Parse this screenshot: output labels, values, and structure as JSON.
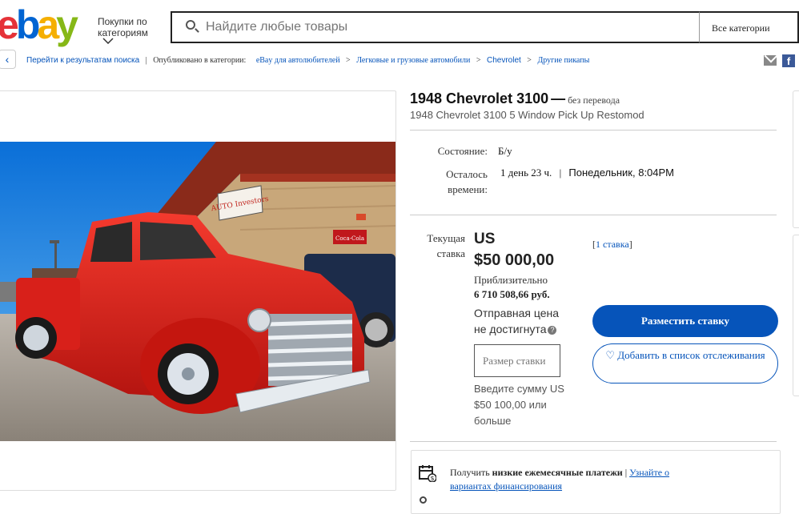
{
  "header": {
    "logo": {
      "e": "e",
      "b": "b",
      "a": "a",
      "y": "y"
    },
    "shop_by_category": "Покупки по категориям",
    "search_placeholder": "Найдите любые товары",
    "category_select": "Все категории"
  },
  "breadcrumb": {
    "back_link": "Перейти к результатам поиска",
    "published_in": "Опубликовано в категории:",
    "items": [
      "eBay для автолюбителей",
      "Легковые и грузовые автомобили",
      "Chevrolet",
      "Другие пикапы"
    ]
  },
  "listing": {
    "title": "1948 Chevrolet 3100",
    "title_dash": "—",
    "no_translation": "без перевода",
    "subtitle": "1948 Chevrolet 3100 5 Window Pick Up Restomod",
    "condition_label": "Состояние:",
    "condition_value": "Б/у",
    "time_left_label": "Осталось времени:",
    "time_left_value": "1 день 23 ч.",
    "time_sep": "|",
    "end_time": "Понедельник, 8:04PM",
    "current_bid_label": "Текущая ставка",
    "currency": "US",
    "price": "$50 000,00",
    "approx_label": "Приблизительно",
    "approx_value": "6 710 508,66 руб.",
    "reserve_text": "Отправная цена не достигнута",
    "bid_input_placeholder": "Размер ставки",
    "bid_hint": "Введите сумму US $50 100,00 или больше",
    "bids_count": "1 ставка",
    "place_bid_button": "Разместить ставку",
    "watchlist_button": "Добавить в список отслеживания",
    "finance_text_pre": "Получить",
    "finance_text_bold": "низкие ежемесячные платежи",
    "finance_text_sep": "|",
    "finance_link": "Узнайте о вариантах финансирования"
  },
  "photo": {
    "sign_text": "AUTO Investors",
    "coca_cola": "Coca-Cola"
  },
  "colors": {
    "link": "#0654ba",
    "button_primary": "#0654ba",
    "truck_red": "#e0201c"
  },
  "icons": [
    "search-icon",
    "chevron-down-icon",
    "chevron-left-icon",
    "mail-icon",
    "facebook-icon",
    "help-icon",
    "heart-icon",
    "calendar-dollar-icon"
  ]
}
